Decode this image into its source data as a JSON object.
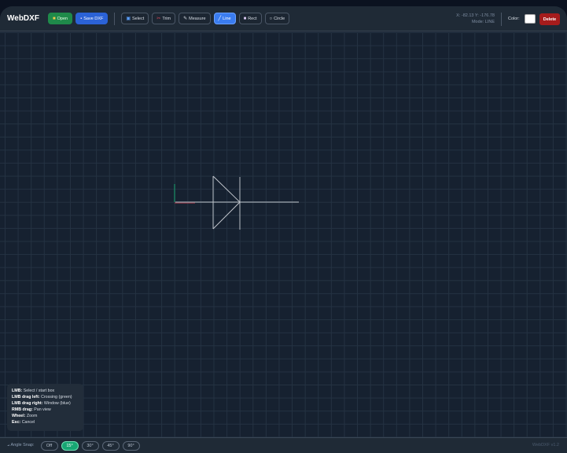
{
  "app": {
    "title": "WebDXF",
    "version": "WebDXF v1.2"
  },
  "toolbar": {
    "open": {
      "label": "Open",
      "icon": "folder-icon"
    },
    "save": {
      "label": "Save DXF",
      "icon": "floppy-icon"
    },
    "tools": [
      {
        "label": "Select",
        "icon": "cursor-icon",
        "active": false
      },
      {
        "label": "Trim",
        "icon": "scissors-icon",
        "active": false
      },
      {
        "label": "Measure",
        "icon": "ruler-icon",
        "active": false
      },
      {
        "label": "Line",
        "icon": "line-icon",
        "active": true
      },
      {
        "label": "Rect",
        "icon": "square-icon",
        "active": false
      },
      {
        "label": "Circle",
        "icon": "circle-icon",
        "active": false
      }
    ],
    "coords": "X: -82.13 Y: -176.78",
    "mode": "Mode: LINE",
    "color_label": "Color:",
    "color_value": "#ffffff",
    "delete": "Delete"
  },
  "help": [
    {
      "key": "LMB:",
      "desc": "Select / start box"
    },
    {
      "key": "LMB drag left:",
      "desc": "Crossing (green)"
    },
    {
      "key": "LMB drag right:",
      "desc": "Window (blue)"
    },
    {
      "key": "RMB drag:",
      "desc": "Pan view"
    },
    {
      "key": "Wheel:",
      "desc": "Zoom"
    },
    {
      "key": "Esc:",
      "desc": "Cancel"
    }
  ],
  "snap": {
    "label": "Angle Snap:",
    "options": [
      "Off",
      "15°",
      "30°",
      "45°",
      "90°"
    ],
    "selected": "15°"
  },
  "colors": {
    "accent": "#3a7cf0",
    "open": "#1f8a4a",
    "save": "#2b62d6",
    "delete": "#a51c1c",
    "snap_on": "#17a673"
  }
}
